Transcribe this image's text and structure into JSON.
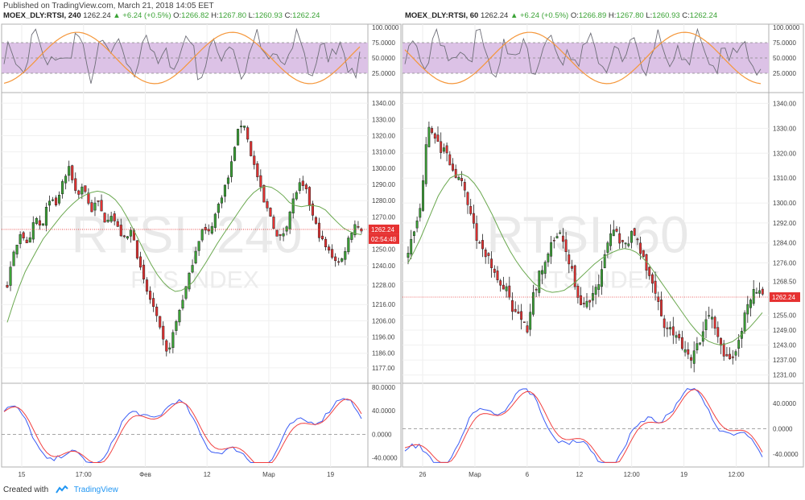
{
  "header": {
    "published": "Published on TradingView.com, March 21, 2018 14:05 EET"
  },
  "footer": {
    "created_with": "Created with",
    "brand": "TradingView"
  },
  "colors": {
    "up": "#3ba336",
    "down": "#e63232",
    "ma": "#6aa84f",
    "rsi_band": "#dcc2e6",
    "rsi_line": "#6e6e78",
    "rsi_ma": "#f5973b",
    "osc_fast": "#3b5cf5",
    "osc_slow": "#f24040",
    "price_line": "#e63232"
  },
  "panels": [
    {
      "symbol": "MOEX_DLY:RTSI, 240",
      "last": "1262.24",
      "change": "▲ +6.24 (+0.5%)",
      "o": "1266.82",
      "h": "1267.80",
      "l": "1260.93",
      "c": "1262.24",
      "watermark_main": "RTSI, 240",
      "watermark_sub": "RTS INDEX",
      "price_label": "1262.24",
      "countdown_label": "02:54:48",
      "time_labels": [
        "15",
        "17:00",
        "Фев",
        "12",
        "Мар",
        "19"
      ]
    },
    {
      "symbol": "MOEX_DLY:RTSI, 60",
      "last": "1262.24",
      "change": "▲ +6.24 (+0.5%)",
      "o": "1266.89",
      "h": "1267.80",
      "l": "1260.93",
      "c": "1262.24",
      "watermark_main": "RTSI, 60",
      "watermark_sub": "RTS INDEX",
      "price_label": "1262.24",
      "time_labels": [
        "26",
        "Мар",
        "6",
        "12",
        "12:00",
        "19",
        "12:00"
      ]
    }
  ],
  "chart_data": [
    {
      "type": "candlestick",
      "title": "MOEX_DLY:RTSI, 240",
      "price_axis": {
        "ylim": [
          1168,
          1346
        ],
        "ticks": [
          "1340.00",
          "1330.00",
          "1320.00",
          "1310.00",
          "1300.00",
          "1290.00",
          "1280.00",
          "1270.00",
          "1250.00",
          "1240.00",
          "1228.00",
          "1216.00",
          "1206.00",
          "1196.00",
          "1186.00",
          "1177.00"
        ]
      },
      "last_price": 1262.24,
      "close_path": [
        1228,
        1248,
        1262,
        1250,
        1270,
        1262,
        1282,
        1276,
        1292,
        1300,
        1283,
        1290,
        1273,
        1280,
        1268,
        1272,
        1262,
        1255,
        1263,
        1240,
        1225,
        1215,
        1200,
        1185,
        1200,
        1216,
        1230,
        1248,
        1262,
        1260,
        1272,
        1285,
        1296,
        1320,
        1330,
        1310,
        1295,
        1278,
        1270,
        1255,
        1262,
        1278,
        1290,
        1286,
        1270,
        1258,
        1250,
        1245,
        1241,
        1255,
        1266,
        1262
      ],
      "ma_path": [
        1205,
        1222,
        1236,
        1246,
        1256,
        1263,
        1270,
        1276,
        1281,
        1284,
        1286,
        1285,
        1282,
        1275,
        1265,
        1254,
        1243,
        1234,
        1227,
        1224,
        1225,
        1230,
        1238,
        1247,
        1256,
        1264,
        1272,
        1280,
        1286,
        1289,
        1288,
        1284,
        1278,
        1276,
        1277,
        1277,
        1274,
        1268,
        1263,
        1260,
        1259
      ],
      "rsi": {
        "ticks": [
          "100.0000",
          "75.0000",
          "50.0000",
          "25.0000"
        ],
        "bands": [
          25,
          75
        ]
      },
      "oscillator": {
        "ticks": [
          "80.0000",
          "40.0000",
          "0.0000",
          "-40.0000"
        ],
        "ylim": [
          -50,
          80
        ]
      }
    },
    {
      "type": "candlestick",
      "title": "MOEX_DLY:RTSI, 60",
      "price_axis": {
        "ylim": [
          1228,
          1344
        ],
        "ticks": [
          "1340.00",
          "1330.00",
          "1320.00",
          "1310.00",
          "1300.00",
          "1292.00",
          "1284.00",
          "1276.00",
          "1268.50",
          "1255.00",
          "1249.00",
          "1243.00",
          "1237.00",
          "1231.00"
        ]
      },
      "last_price": 1262.24,
      "close_path": [
        1278,
        1290,
        1300,
        1330,
        1328,
        1322,
        1318,
        1312,
        1310,
        1300,
        1290,
        1282,
        1280,
        1272,
        1268,
        1265,
        1255,
        1255,
        1248,
        1262,
        1272,
        1276,
        1285,
        1290,
        1282,
        1272,
        1262,
        1258,
        1264,
        1268,
        1278,
        1290,
        1286,
        1282,
        1288,
        1284,
        1276,
        1268,
        1260,
        1252,
        1248,
        1246,
        1240,
        1238,
        1242,
        1250,
        1256,
        1250,
        1240,
        1236,
        1242,
        1252,
        1262,
        1266,
        1262
      ],
      "ma_path": [
        1276,
        1284,
        1294,
        1304,
        1310,
        1312,
        1310,
        1304,
        1296,
        1287,
        1279,
        1273,
        1268,
        1265,
        1264,
        1265,
        1268,
        1272,
        1276,
        1279,
        1281,
        1282,
        1280,
        1276,
        1270,
        1264,
        1258,
        1252,
        1247,
        1244,
        1243,
        1244,
        1247,
        1251,
        1256
      ],
      "rsi": {
        "ticks": [
          "100.0000",
          "75.0000",
          "50.0000",
          "25.0000"
        ],
        "bands": [
          25,
          75
        ]
      },
      "oscillator": {
        "ticks": [
          "40.0000",
          "0.0000",
          "-40.0000"
        ],
        "ylim": [
          -55,
          65
        ]
      }
    }
  ]
}
